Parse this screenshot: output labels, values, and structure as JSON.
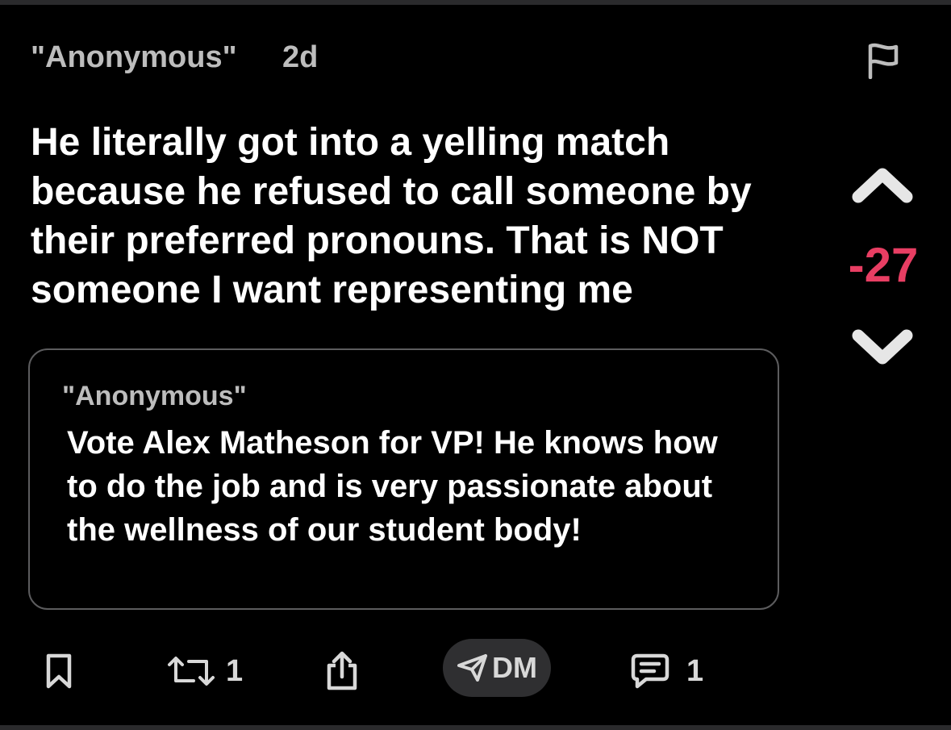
{
  "post": {
    "author": "\"Anonymous\"",
    "age": "2d",
    "body": "He literally got into a yelling match because he refused to call someone by their preferred pronouns. That is NOT someone I want representing me",
    "score": "-27",
    "score_color": "#e83e63",
    "icons": {
      "flag": "flag-icon",
      "upvote": "chevron-up-icon",
      "downvote": "chevron-down-icon"
    }
  },
  "quoted_post": {
    "author": "\"Anonymous\"",
    "body": "Vote Alex Matheson for VP! He knows how to do the job and is very passionate about the wellness of our student body!"
  },
  "actions": {
    "bookmark_icon": "bookmark-icon",
    "repost_icon": "repost-icon",
    "repost_count": "1",
    "share_icon": "share-icon",
    "dm_icon": "paper-plane-icon",
    "dm_label": "DM",
    "comment_icon": "comment-icon",
    "comment_count": "1"
  }
}
